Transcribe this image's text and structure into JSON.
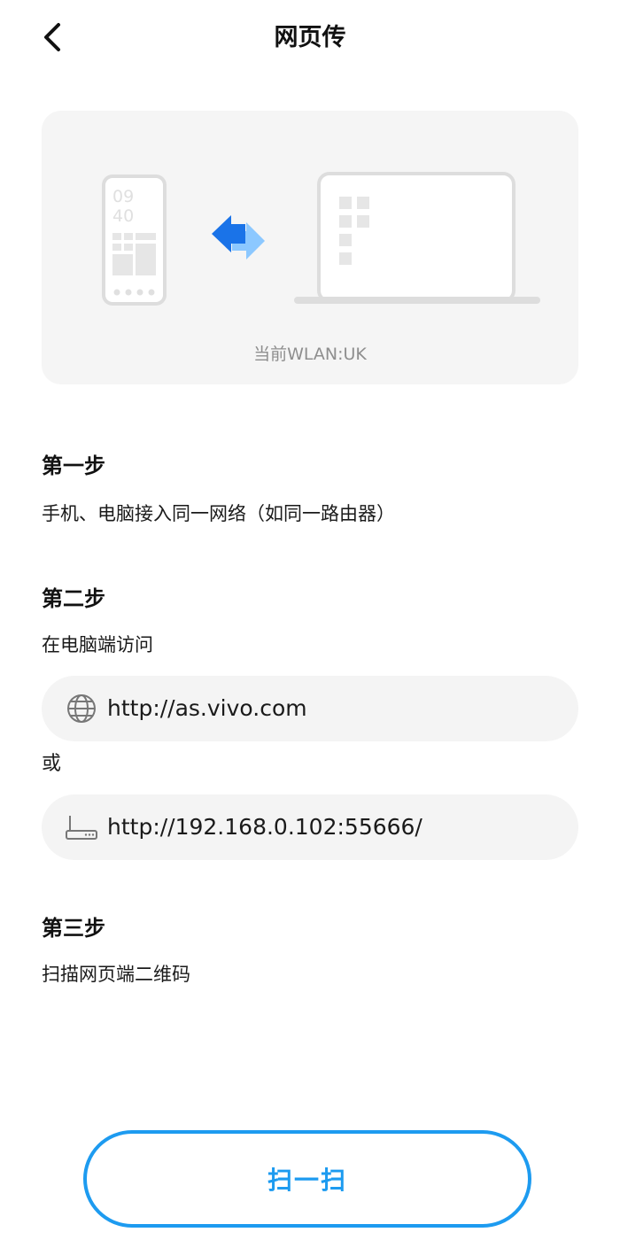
{
  "header": {
    "title": "网页传",
    "back_icon": "chevron-left-icon"
  },
  "illustration": {
    "phone_time": [
      "09",
      "40"
    ],
    "wlan_label": "当前WLAN:UK",
    "colors": {
      "card_bg": "#f5f5f5",
      "device_stroke": "#dddddd",
      "arrow_primary": "#1a73e8",
      "arrow_secondary": "#8cc8ff"
    }
  },
  "steps": [
    {
      "title": "第一步",
      "description": "手机、电脑接入同一网络（如同一路由器）"
    },
    {
      "title": "第二步",
      "description": "在电脑端访问",
      "urls": [
        {
          "icon": "globe-icon",
          "text": "http://as.vivo.com"
        },
        {
          "icon": "router-icon",
          "text": "http://192.168.0.102:55666/"
        }
      ],
      "or_label": "或"
    },
    {
      "title": "第三步",
      "description": "扫描网页端二维码"
    }
  ],
  "scan_button": {
    "label": "扫一扫",
    "color": "#1d9bf0"
  }
}
